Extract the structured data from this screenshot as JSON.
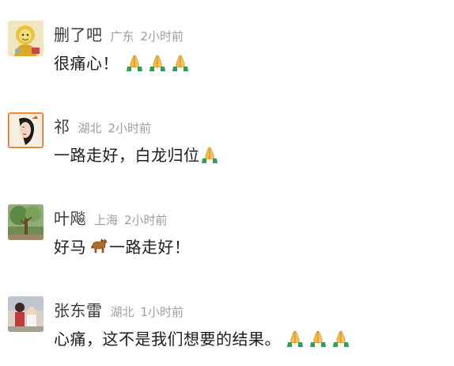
{
  "comments": [
    {
      "username": "删了吧",
      "location": "广东",
      "time": "2小时前",
      "text": "很痛心！",
      "emojis": [
        "pray-emoji",
        "pray-emoji",
        "pray-emoji"
      ]
    },
    {
      "username": "祁",
      "location": "湖北",
      "time": "2小时前",
      "text": "一路走好，白龙归位",
      "emojis": [
        "pray-emoji"
      ]
    },
    {
      "username": "叶飚",
      "location": "上海",
      "time": "2小时前",
      "text_before": "好马",
      "text_after": "一路走好！",
      "emojis": [
        "horse-emoji"
      ]
    },
    {
      "username": "张东雷",
      "location": "湖北",
      "time": "1小时前",
      "text": "心痛，这不是我们想要的结果。",
      "emojis": [
        "pray-emoji",
        "pray-emoji",
        "pray-emoji"
      ]
    }
  ],
  "colors": {
    "username": "#3a3a3a",
    "meta": "#9d9d9d",
    "text": "#1c1c1c",
    "background": "#ffffff"
  }
}
